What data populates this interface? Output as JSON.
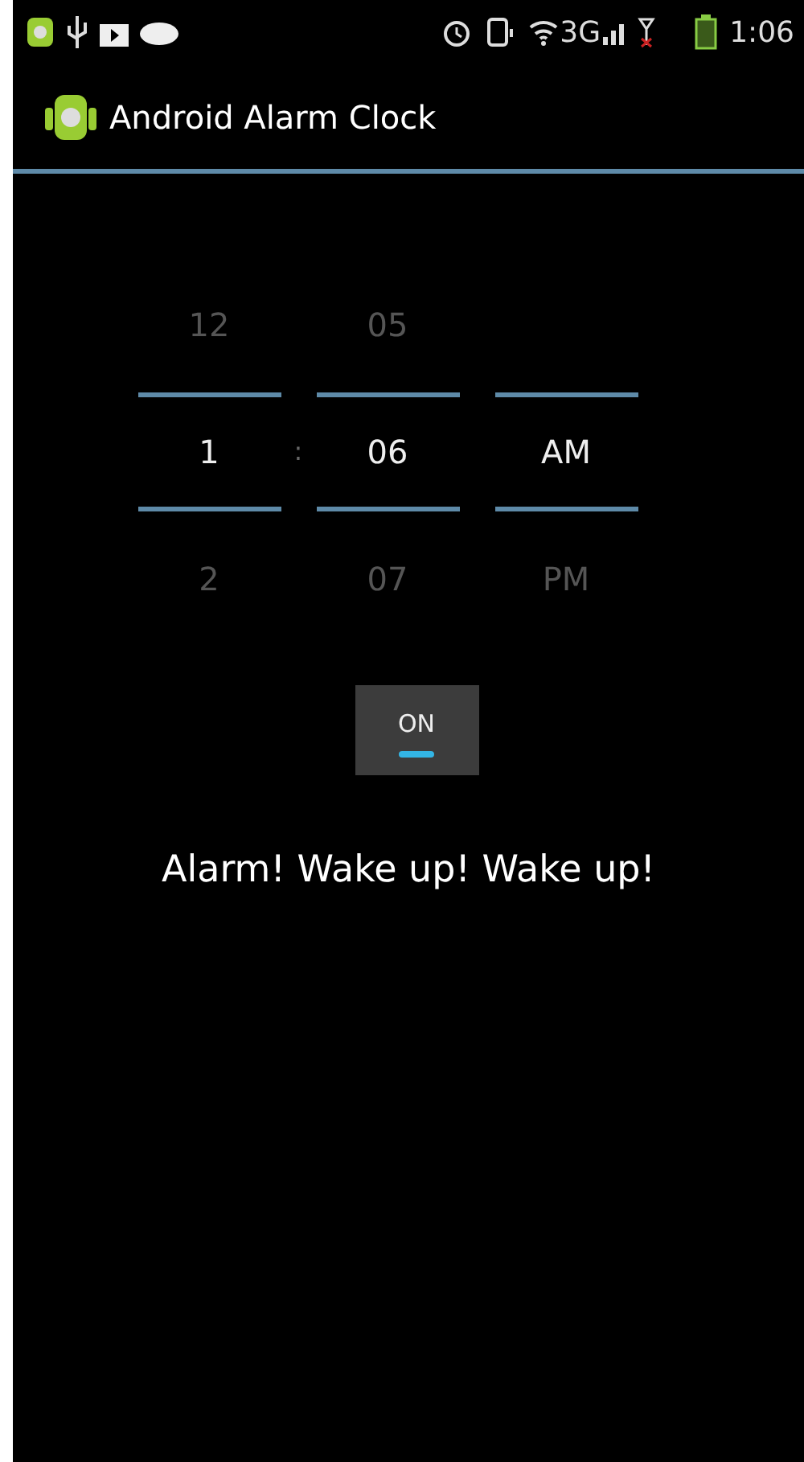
{
  "status_bar": {
    "network": "3G",
    "time": "1:06"
  },
  "action_bar": {
    "title": "Android Alarm Clock"
  },
  "time_picker": {
    "separator": ":",
    "columns": [
      {
        "values": [
          {
            "text": "12",
            "selected": false
          },
          {
            "text": "1",
            "selected": true
          },
          {
            "text": "2",
            "selected": false
          }
        ]
      },
      {
        "values": [
          {
            "text": "05",
            "selected": false
          },
          {
            "text": "06",
            "selected": true
          },
          {
            "text": "07",
            "selected": false
          }
        ]
      },
      {
        "values": [
          {
            "text": "AM",
            "selected": true
          },
          {
            "text": "PM",
            "selected": false
          }
        ]
      }
    ]
  },
  "toggle": {
    "label": "ON",
    "on": true
  },
  "message": "Alarm! Wake up! Wake up!"
}
